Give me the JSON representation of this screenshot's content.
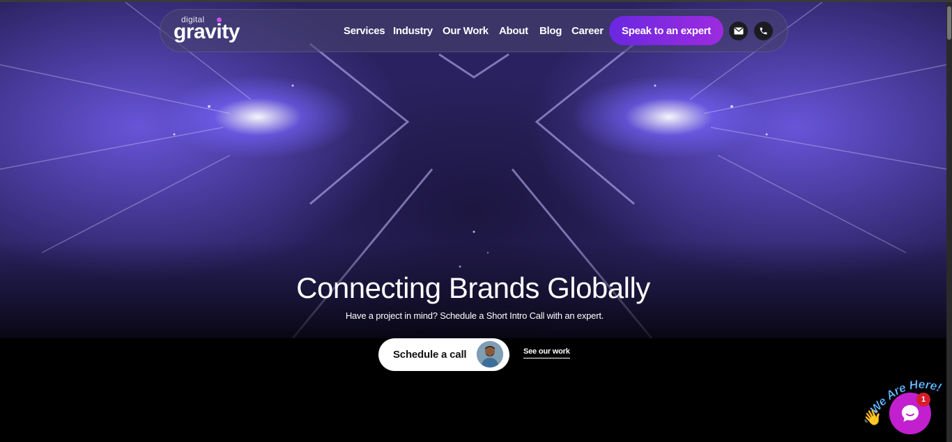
{
  "brand": {
    "logo_small": "digital",
    "logo_big": "gravity"
  },
  "nav": {
    "items": [
      {
        "label": "Services"
      },
      {
        "label": "Industry"
      },
      {
        "label": "Our Work"
      },
      {
        "label": "About"
      },
      {
        "label": "Blog"
      },
      {
        "label": "Career"
      }
    ],
    "cta_label": "Speak to an expert",
    "icons": [
      "mail-icon",
      "phone-icon"
    ]
  },
  "hero": {
    "headline": "Connecting Brands Globally",
    "subline": "Have a project in mind? Schedule a Short Intro Call with an expert.",
    "primary_button": "Schedule a call",
    "secondary_link": "See our work"
  },
  "chat": {
    "banner": "We Are Here!",
    "badge_count": "1",
    "icons": [
      "waving-hand-icon",
      "chat-bubble-icon"
    ]
  },
  "colors": {
    "accent_start": "#6a28e0",
    "accent_end": "#9d2bdf",
    "chat": "#c21fcf",
    "badge": "#d61d2b"
  }
}
